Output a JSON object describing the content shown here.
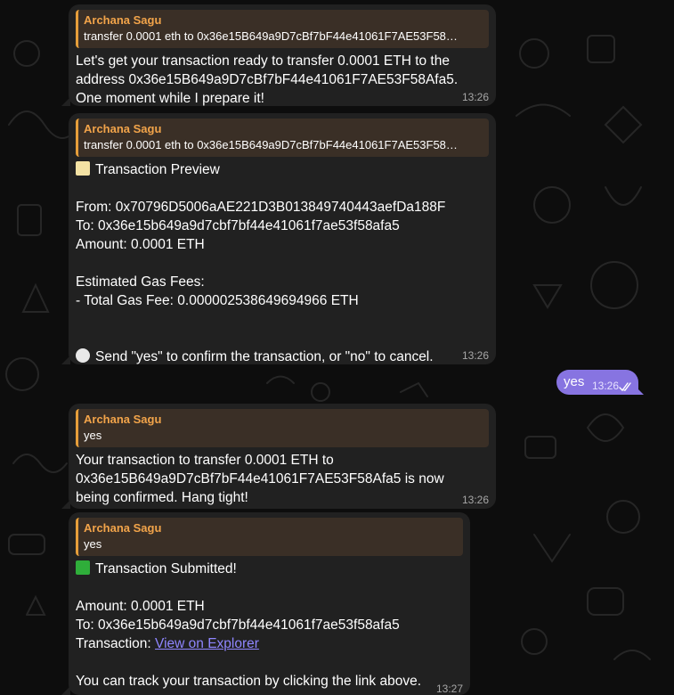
{
  "colors": {
    "background": "#0d0d0d",
    "incoming_bubble": "#212121",
    "outgoing_bubble": "#8774e1",
    "reply_accent": "#e59e3a",
    "reply_author": "#f2a44a",
    "link": "#8f86ff"
  },
  "messages": [
    {
      "reply": {
        "author": "Archana Sagu",
        "text": "transfer 0.0001 eth to 0x36e15B649a9D7cBf7bF44e41061F7AE53F58…"
      },
      "lines": [
        "Let's get your transaction ready to transfer 0.0001 ETH to the",
        "address 0x36e15B649a9D7cBf7bF44e41061F7AE53F58Afa5.",
        "One moment while I prepare it!"
      ],
      "time": "13:26"
    },
    {
      "reply": {
        "author": "Archana Sagu",
        "text": "transfer 0.0001 eth to 0x36e15B649a9D7cBf7bF44e41061F7AE53F58…"
      },
      "emoji_icon": "memo-icon",
      "title": "Transaction Preview",
      "lines": [
        "",
        "From: 0x70796D5006aAE221D3B013849740443aefDa188F",
        "To: 0x36e15b649a9d7cbf7bf44e41061f7ae53f58afa5",
        "Amount: 0.0001 ETH",
        "",
        "Estimated Gas Fees:",
        "- Total Gas Fee: 0.000002538649694966 ETH",
        "",
        ""
      ],
      "footer_emoji_icon": "speech-bubble-icon",
      "footer": "Send \"yes\" to confirm the transaction, or \"no\" to cancel.",
      "time": "13:26"
    },
    {
      "reply": {
        "author": "Archana Sagu",
        "text": "yes"
      },
      "lines": [
        "Your transaction to transfer 0.0001 ETH to",
        "0x36e15B649a9D7cBf7bF44e41061F7AE53F58Afa5 is now",
        "being confirmed. Hang tight!"
      ],
      "time": "13:26"
    },
    {
      "reply": {
        "author": "Archana Sagu",
        "text": "yes"
      },
      "emoji_icon": "check-mark-icon",
      "title": "Transaction Submitted!",
      "lines": [
        "",
        "Amount: 0.0001 ETH",
        "To: 0x36e15b649a9d7cbf7bf44e41061f7ae53f58afa5"
      ],
      "transaction_label": "Transaction: ",
      "link_text": "View on Explorer",
      "after_lines": [
        "",
        "You can track your transaction by clicking the link above."
      ],
      "time": "13:27"
    }
  ],
  "outgoing": {
    "text": "yes",
    "time": "13:26",
    "status_icon": "double-check-icon"
  }
}
